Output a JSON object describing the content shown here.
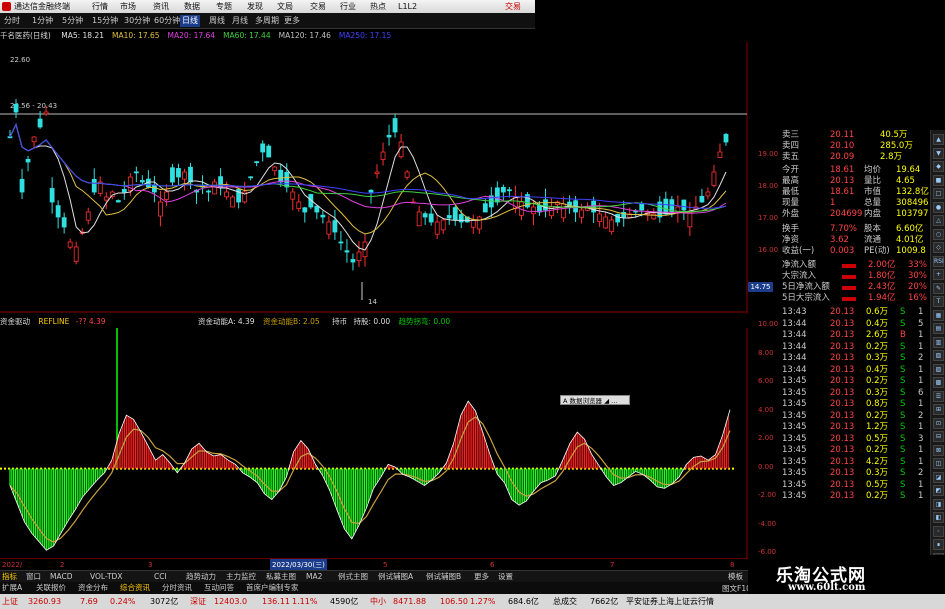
{
  "titlebar": {
    "app_name": "通达信金融终端",
    "menus": [
      "行情",
      "市场",
      "资讯",
      "数据",
      "专题",
      "发现",
      "文局",
      "交易",
      "行业",
      "热点",
      "L1L2"
    ],
    "trade_link": "交易"
  },
  "toolbar": {
    "periods": [
      "分时",
      "1分钟",
      "5分钟",
      "15分钟",
      "30分钟",
      "60分钟",
      "日线",
      "周线",
      "月线",
      "多周期",
      "更多"
    ],
    "active_period": "日线"
  },
  "stock": {
    "name": "千名医药(日线)"
  },
  "ma_legend": [
    {
      "label": "MA5: 18.21",
      "color": "#e0e0e0"
    },
    {
      "label": "MA10: 17.65",
      "color": "#e0c040"
    },
    {
      "label": "MA20: 17.64",
      "color": "#e040e0"
    },
    {
      "label": "MA60: 17.44",
      "color": "#40d040"
    },
    {
      "label": "MA120: 17.46",
      "color": "#c0c0c0"
    },
    {
      "label": "MA250: 17.15",
      "color": "#4040ff"
    }
  ],
  "price_labels": {
    "high_mark": "22.60",
    "range_mark": "20.56 - 20.43",
    "low_mark": "14",
    "current_price_tag": "14.75"
  },
  "price_axis": [
    "19.00",
    "18.00",
    "17.00",
    "16.00"
  ],
  "indicator_header": {
    "name": "资金驱动",
    "refline": "REFLINE",
    "refline_value": "-?? 4.39",
    "fund_power": "资金动能A: 4.39",
    "fund_power2": "资金动能B: 2.05",
    "hold": "持币",
    "hold_value": "持股: 0.00",
    "trend": "趋势拐弯: 0.00"
  },
  "indicator_axis": [
    "10.00",
    "8.00",
    "6.00",
    "4.00",
    "2.00",
    "0.00",
    "-2.00",
    "-4.00",
    "-6.00"
  ],
  "quote": {
    "top_rows": [
      {
        "label": "卖三",
        "price": "20.11",
        "vol": "40.5万"
      },
      {
        "label": "卖四",
        "price": "20.10",
        "vol": "285.0万"
      },
      {
        "label": "卖五",
        "price": "20.09",
        "vol": "2.8万"
      }
    ],
    "stats": [
      {
        "l1": "今开",
        "v1": "18.61",
        "l2": "均价",
        "v2": "19.64"
      },
      {
        "l1": "最高",
        "v1": "20.13",
        "l2": "量比",
        "v2": "4.65"
      },
      {
        "l1": "最低",
        "v1": "18.61",
        "l2": "市值",
        "v2": "132.8亿"
      },
      {
        "l1": "现量",
        "v1": "1",
        "l2": "总量",
        "v2": "308496"
      },
      {
        "l1": "外盘",
        "v1": "204699",
        "l2": "内盘",
        "v2": "103797"
      },
      {
        "l1": "换手",
        "v1": "7.70%",
        "l2": "股本",
        "v2": "6.60亿"
      },
      {
        "l1": "净资",
        "v1": "3.62",
        "l2": "流通",
        "v2": "4.01亿"
      },
      {
        "l1": "收益(一)",
        "v1": "0.003",
        "l2": "PE(动)",
        "v2": "1009.8"
      }
    ],
    "flows": [
      {
        "label": "净流入额",
        "value": "2.00亿",
        "pct": "33%"
      },
      {
        "label": "大宗流入",
        "value": "1.80亿",
        "pct": "30%"
      },
      {
        "label": "5日净流入额",
        "value": "2.43亿",
        "pct": "20%"
      },
      {
        "label": "5日大宗流入",
        "value": "1.94亿",
        "pct": "16%"
      }
    ],
    "ticks": [
      {
        "time": "13:43",
        "price": "20.13",
        "vol": "0.6万",
        "bs": "S",
        "n": "1"
      },
      {
        "time": "13:44",
        "price": "20.13",
        "vol": "0.4万",
        "bs": "S",
        "n": "5"
      },
      {
        "time": "13:44",
        "price": "20.13",
        "vol": "2.6万",
        "bs": "B",
        "n": "1"
      },
      {
        "time": "13:44",
        "price": "20.13",
        "vol": "0.2万",
        "bs": "S",
        "n": "1"
      },
      {
        "time": "13:44",
        "price": "20.13",
        "vol": "0.3万",
        "bs": "S",
        "n": "2"
      },
      {
        "time": "13:44",
        "price": "20.13",
        "vol": "0.4万",
        "bs": "S",
        "n": "1"
      },
      {
        "time": "13:45",
        "price": "20.13",
        "vol": "0.2万",
        "bs": "S",
        "n": "1"
      },
      {
        "time": "13:45",
        "price": "20.13",
        "vol": "0.3万",
        "bs": "S",
        "n": "6"
      },
      {
        "time": "13:45",
        "price": "20.13",
        "vol": "0.8万",
        "bs": "S",
        "n": "1"
      },
      {
        "time": "13:45",
        "price": "20.13",
        "vol": "0.2万",
        "bs": "S",
        "n": "2"
      },
      {
        "time": "13:45",
        "price": "20.13",
        "vol": "1.2万",
        "bs": "S",
        "n": "1"
      },
      {
        "time": "13:45",
        "price": "20.13",
        "vol": "0.5万",
        "bs": "S",
        "n": "3"
      },
      {
        "time": "13:45",
        "price": "20.13",
        "vol": "0.2万",
        "bs": "S",
        "n": "1"
      },
      {
        "time": "13:45",
        "price": "20.13",
        "vol": "4.2万",
        "bs": "S",
        "n": "1"
      },
      {
        "time": "13:45",
        "price": "20.13",
        "vol": "0.3万",
        "bs": "S",
        "n": "2"
      },
      {
        "time": "13:45",
        "price": "20.13",
        "vol": "0.5万",
        "bs": "S",
        "n": "1"
      },
      {
        "time": "13:45",
        "price": "20.13",
        "vol": "0.2万",
        "bs": "S",
        "n": "1"
      }
    ]
  },
  "tooltip": "A 数据浏览器 ◢ ...",
  "date_axis": {
    "start": "2022/",
    "mid": "2022/03/30(三)",
    "ticks": [
      "2",
      "3",
      "5",
      "6",
      "7",
      "8"
    ]
  },
  "bottom_tabs": [
    "指标",
    "窗口",
    "MACD",
    "VOL-TDX",
    "CCI",
    "趋势动力",
    "主力监控",
    "私募主图",
    "MA2",
    "例式主图",
    "例试辅图A",
    "例试辅图B",
    "更多",
    "设置"
  ],
  "bottom_tabs2": [
    "扩展A",
    "关联报价",
    "资金分布",
    "综合资讯",
    "分时资讯",
    "互动问答",
    "首席户编制专家"
  ],
  "right_tab": "模板",
  "right_tab2": "图文F10",
  "status": {
    "sh_label": "上证",
    "sh_value": "3260.93",
    "sh_chg": "7.69",
    "sh_pct": "0.24%",
    "sh_amt": "3072亿",
    "sz_label": "深证",
    "sz_value": "12403.0",
    "sz_chg": "136.11",
    "sz_pct": "1.11%",
    "sz_amt": "4590亿",
    "zx_label": "中小",
    "zx_value": "8471.88",
    "zx_chg": "106.50",
    "zx_pct": "1.27%",
    "zx_amt": "684.6亿",
    "total_label": "总成交",
    "total_value": "7662亿",
    "broker": "平安证券上海上证云行情"
  },
  "brand": {
    "name": "乐淘公式网",
    "url": "www.60lt.com"
  },
  "sidebar_buttons": [
    "▲",
    "▼",
    "◆",
    "■",
    "□",
    "●",
    "△",
    "○",
    "◇",
    "RSI",
    "+",
    "✎",
    "T",
    "▦",
    "▤",
    "▥",
    "▧",
    "▨",
    "▩",
    "☰",
    "⊞",
    "⊡",
    "⊟",
    "⊠",
    "◫",
    "◪",
    "◩",
    "◨",
    "◧",
    "◦",
    "∎",
    "⊕"
  ],
  "chart_data": [
    {
      "type": "candlestick",
      "title": "千名医药(日线)",
      "ylim": [
        14,
        22.6
      ],
      "note": "daily candles with MA5/MA10/MA20/MA60/MA120/MA250"
    },
    {
      "type": "bar",
      "title": "资金驱动",
      "ylim": [
        -6,
        10
      ],
      "values": [
        -1.2,
        -2.5,
        -3.8,
        -4.6,
        -5.2,
        -5.8,
        -5.5,
        -4.6,
        -3.7,
        -2.9,
        -2.0,
        -1.4,
        -0.8,
        -0.3,
        0.6,
        2.5,
        3.8,
        3.5,
        2.6,
        1.6,
        0.6,
        1.0,
        0.4,
        -0.3,
        0.4,
        1.4,
        1.8,
        1.2,
        0.9,
        1.0,
        0.6,
        0.3,
        -0.3,
        -0.6,
        -1.0,
        -1.8,
        -2.2,
        -1.6,
        -0.6,
        1.2,
        2.0,
        1.4,
        0.3,
        -0.5,
        -1.6,
        -3.0,
        -4.3,
        -5.0,
        -4.0,
        -2.8,
        -1.4,
        -0.6,
        0.3,
        0.1,
        -0.4,
        -0.6,
        -0.9,
        -1.2,
        -0.8,
        -0.3,
        0.4,
        1.8,
        3.8,
        4.8,
        4.1,
        2.6,
        1.0,
        -0.4,
        -1.0,
        -2.2,
        -2.6,
        -2.3,
        -1.6,
        -1.0,
        -0.8,
        -0.5,
        0.6,
        1.8,
        2.6,
        2.1,
        1.0,
        0.2,
        -0.6,
        -1.2,
        -1.0,
        -0.6,
        -0.2,
        -0.4,
        -0.8,
        -1.3,
        -1.4,
        -1.1,
        -0.6,
        0.3,
        0.8,
        0.9,
        0.6,
        1.0,
        2.4,
        4.2
      ]
    }
  ]
}
